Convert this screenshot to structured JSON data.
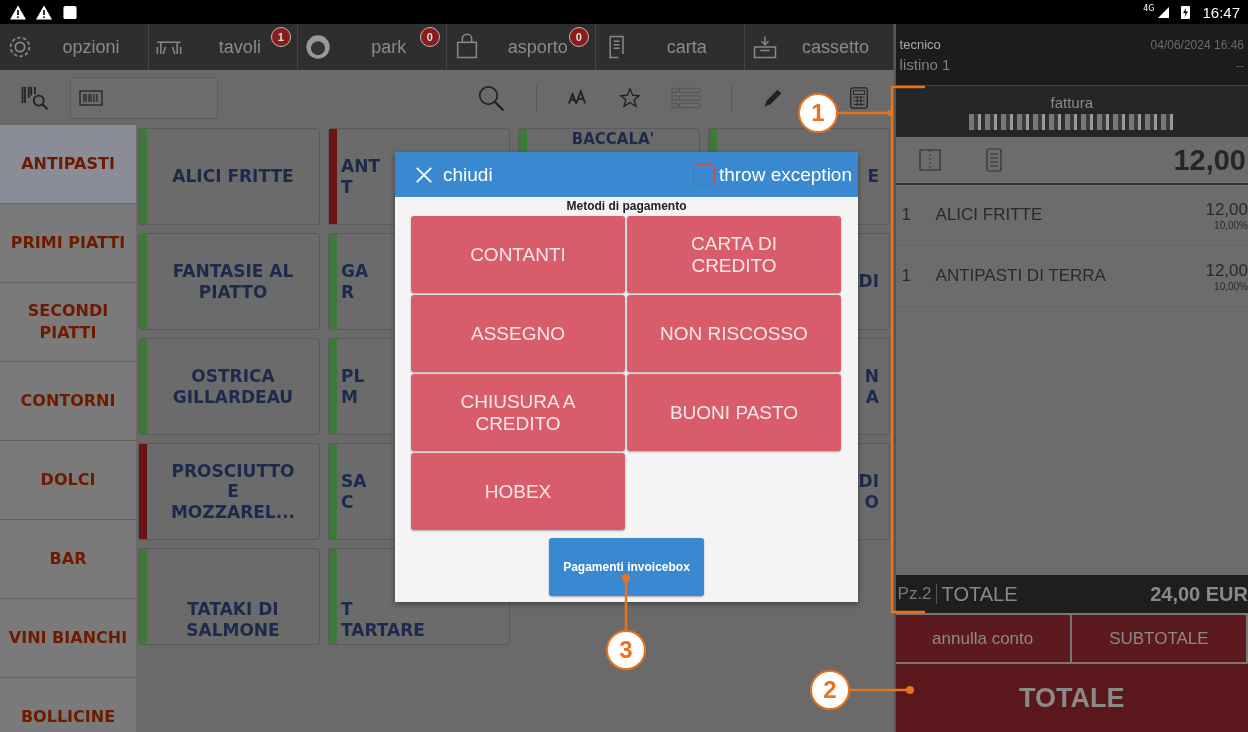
{
  "status_bar": {
    "time": "16:47",
    "network": "4G"
  },
  "nav": [
    {
      "label": "opzioni"
    },
    {
      "label": "tavoli",
      "badge": "1"
    },
    {
      "label": "park",
      "badge": "0"
    },
    {
      "label": "asporto",
      "badge": "0"
    },
    {
      "label": "carta"
    },
    {
      "label": "cassetto"
    }
  ],
  "categories": [
    {
      "label": "ANTIPASTI",
      "selected": true
    },
    {
      "label": "PRIMI PIATTI",
      "selected": false
    },
    {
      "label": "SECONDI PIATTI",
      "selected": false
    },
    {
      "label": "CONTORNI",
      "selected": false
    },
    {
      "label": "DOLCI",
      "selected": false
    },
    {
      "label": "BAR",
      "selected": false
    },
    {
      "label": "VINI BIANCHI",
      "selected": false
    },
    {
      "label": "BOLLICINE",
      "selected": false
    }
  ],
  "product_columns": [
    [
      {
        "lines": [
          "ALICI FRITTE"
        ],
        "color": "#3d7a39"
      },
      {
        "lines": [
          "FANTASIE AL",
          "PIATTO"
        ],
        "color": "#3d7a39"
      },
      {
        "lines": [
          "OSTRICA",
          "GILLARDEAU"
        ],
        "color": "#3d7a39"
      },
      {
        "lines": [
          "PROSCIUTTO",
          "E",
          "MOZZAREL..."
        ],
        "color": "#6a1418"
      },
      {
        "lines": [
          "TATAKI DI",
          "SALMONE"
        ],
        "color": "#3d7a39"
      }
    ],
    [
      {
        "lines": [
          "ANT",
          "T"
        ],
        "color": "#6a1418"
      },
      {
        "lines": [
          "GA",
          "R"
        ],
        "color": "#3d7a39"
      },
      {
        "lines": [
          "PL",
          "M"
        ],
        "color": "#3d7a39"
      },
      {
        "lines": [
          "SA",
          "C"
        ],
        "color": "#3d7a39"
      },
      {
        "lines": [
          "T",
          "TARTARE"
        ],
        "color": "#3d7a39"
      }
    ],
    [
      {
        "lines": [
          "BACCALA'"
        ],
        "color": "#3d7a39"
      }
    ],
    [
      {
        "lines": [
          "E"
        ],
        "color": "#3d7a39"
      },
      {
        "lines": [
          "DI"
        ]
      },
      {
        "lines": [
          "N",
          "A"
        ]
      },
      {
        "lines": [
          "DI",
          "O"
        ]
      }
    ]
  ],
  "receipt": {
    "user": "tecnico",
    "datetime": "04/06/2024 16:46",
    "price_list": "listino 1",
    "price_list_value": "--",
    "document_type": "fattura",
    "line_total": "12,00",
    "items": [
      {
        "qty": "1",
        "name": "ALICI FRITTE",
        "price": "12,00",
        "vat": "10,00%"
      },
      {
        "qty": "1",
        "name": "ANTIPASTI DI TERRA",
        "price": "12,00",
        "vat": "10,00%"
      }
    ],
    "pieces": "Pz.2",
    "total_label": "TOTALE",
    "total": "24,00 EUR"
  },
  "actions": [
    {
      "label": "annulla conto"
    },
    {
      "label": "SUBTOTALE"
    }
  ],
  "total_button": "TOTALE",
  "dialog": {
    "close_label": "chiudi",
    "checkbox": {
      "label": "throw exception",
      "checked": false
    },
    "title": "Metodi di pagamento",
    "methods": [
      {
        "label": "CONTANTI"
      },
      {
        "label": "CARTA DI CREDITO"
      },
      {
        "label": "ASSEGNO"
      },
      {
        "label": "NON RISCOSSO"
      },
      {
        "label": "CHIUSURA A CREDITO"
      },
      {
        "label": "BUONI PASTO"
      },
      {
        "label": "HOBEX"
      }
    ],
    "footer_button": "Pagamenti invoicebox"
  },
  "callouts": [
    {
      "number": "1"
    },
    {
      "number": "2"
    },
    {
      "number": "3"
    }
  ]
}
